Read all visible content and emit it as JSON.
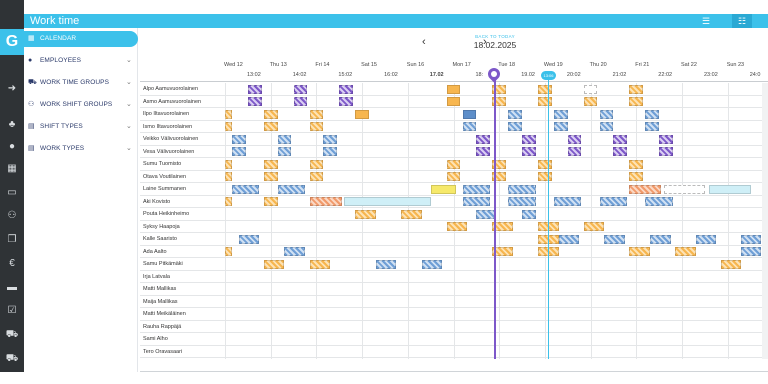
{
  "app": {
    "title": "Work time",
    "logo": "G"
  },
  "topbar": {
    "icons": [
      "list-icon",
      "grid-icon"
    ]
  },
  "sidebar": {
    "items": [
      {
        "label": "CALENDAR",
        "icon": "calendar-icon",
        "active": true,
        "chevron": false
      },
      {
        "label": "EMPLOYEES",
        "icon": "user-icon",
        "active": false,
        "chevron": true
      },
      {
        "label": "WORK TIME GROUPS",
        "icon": "car-icon",
        "active": false,
        "chevron": true
      },
      {
        "label": "WORK SHIFT GROUPS",
        "icon": "group-icon",
        "active": false,
        "chevron": true
      },
      {
        "label": "SHIFT TYPES",
        "icon": "shift-icon",
        "active": false,
        "chevron": true
      },
      {
        "label": "WORK TYPES",
        "icon": "worktype-icon",
        "active": false,
        "chevron": true
      }
    ]
  },
  "rail": {
    "icons": [
      "arrow-right-icon",
      "org-chart-icon",
      "person-icon",
      "building-icon",
      "id-card-icon",
      "people-icon",
      "copy-icon",
      "euro-icon",
      "folder-icon",
      "clipboard-icon",
      "car-icon",
      "train-icon"
    ]
  },
  "header": {
    "back_to_today": "BACK TO TODAY",
    "date": "18.02.2025",
    "prev": "‹",
    "next": "›"
  },
  "timeline": {
    "days": [
      "Wed 12",
      "Thu 13",
      "Fri 14",
      "Sat 15",
      "Sun 16",
      "Mon 17",
      "Tue 18",
      "Wed 19",
      "Thu 20",
      "Fri 21",
      "Sat 22",
      "Sun 23"
    ],
    "dates": [
      "13:02",
      "14:02",
      "15:02",
      "16:02",
      "17.02",
      "18:",
      "19.02",
      "20:02",
      "21:02",
      "22:02",
      "23:02",
      "24:0"
    ],
    "now_label": "",
    "cyan_label": "13:06"
  },
  "employees": [
    "Alpo Aamuvuorolainen",
    "Asmo Aamuvuorolainen",
    "Ilpo Iltavuorolainen",
    "Ismo Iltavuorolainen",
    "Veikko Välivuorolainen",
    "Vesa Välivuorolainen",
    "Sumu Tuomisto",
    "Otava Voutilainen",
    "Laine Summanen",
    "Aki Kovisto",
    "Pouta Heikinheimo",
    "Syksy Haapoja",
    "Kalle Saaristo",
    "Ada Aalto",
    "Samu Pitkämäki",
    "Irja Latvala",
    "Matti Mallikas",
    "Maija Mallikas",
    "Matti Meikäläinen",
    "Rauha Rappäjä",
    "Sami Alho",
    "Tero Oravasaari"
  ],
  "colors": {
    "accent": "#3cc1ea",
    "rail": "#2f3336",
    "now": "#7d58c9",
    "orange": "#f7b64f",
    "blue": "#6f9fd6",
    "purple": "#7d58c9"
  }
}
